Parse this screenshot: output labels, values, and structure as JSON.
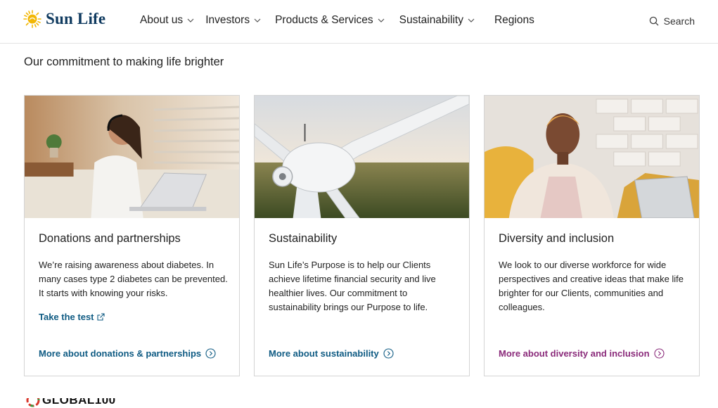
{
  "brand": {
    "name": "Sun Life"
  },
  "nav": {
    "items": [
      {
        "label": "About us",
        "has_menu": true
      },
      {
        "label": "Investors",
        "has_menu": true
      },
      {
        "label": "Products & Services",
        "has_menu": true
      },
      {
        "label": "Sustainability",
        "has_menu": true
      },
      {
        "label": "Regions",
        "has_menu": false
      }
    ],
    "search_label": "Search"
  },
  "intro": {
    "heading": "Our commitment to making life brighter"
  },
  "cards": [
    {
      "title": "Donations and partnerships",
      "description": "We’re raising awareness about diabetes. In many cases type 2 diabetes can be prevented. It starts with knowing your risks.",
      "action_link": "Take the test",
      "more_link": "More about donations & partnerships",
      "link_color": "#0f5b83"
    },
    {
      "title": "Sustainability",
      "description": "Sun Life’s Purpose is to help our Clients achieve lifetime financial security and live healthier lives. Our commitment to sustainability brings our Purpose to life.",
      "more_link": "More about sustainability",
      "link_color": "#0f5b83"
    },
    {
      "title": "Diversity and inclusion",
      "description": "We look to our diverse workforce for wide perspectives and creative ideas that make life brighter for our Clients, communities and colleagues.",
      "more_link": "More about diversity and inclusion",
      "link_color": "#8a2a7a"
    }
  ],
  "footer": {
    "badge_text": "GLOBAL100"
  },
  "colors": {
    "brand_navy": "#0f3a5f",
    "brand_yellow": "#f2b705",
    "link_blue": "#0f5b83",
    "link_purple": "#8a2a7a"
  }
}
